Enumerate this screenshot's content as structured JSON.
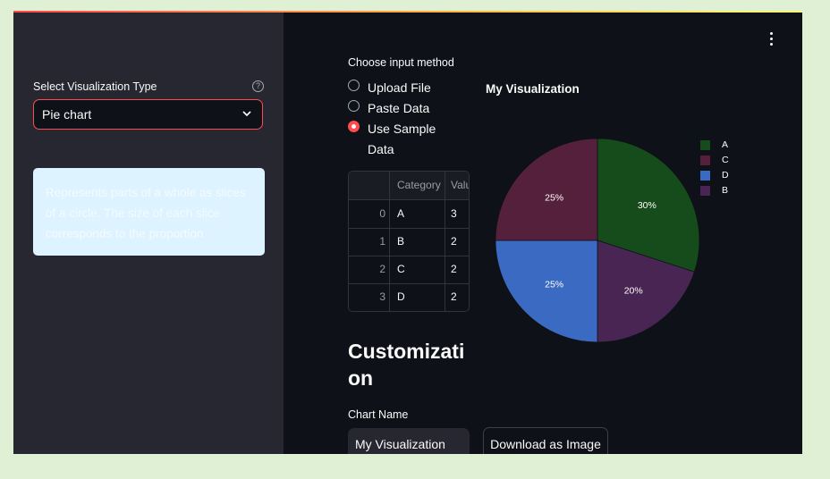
{
  "sidebar": {
    "label": "Select Visualization Type",
    "help_icon": "?",
    "select_value": "Pie chart",
    "info_text": "Represents parts of a whole as slices of a circle. The size of each slice corresponds to the proportion"
  },
  "main": {
    "input_label": "Choose input method",
    "radio_options": [
      {
        "label": "Upload File",
        "selected": false
      },
      {
        "label": "Paste Data",
        "selected": false
      },
      {
        "label": "Use Sample",
        "selected": true
      },
      {
        "label": "Data",
        "selected": false
      }
    ],
    "table": {
      "headers": [
        "",
        "Category",
        "Valu"
      ],
      "rows": [
        [
          "0",
          "A",
          "3"
        ],
        [
          "1",
          "B",
          "2"
        ],
        [
          "2",
          "C",
          "2"
        ],
        [
          "3",
          "D",
          "2"
        ]
      ]
    },
    "heading": "Customizati on",
    "chart_name_label": "Chart Name",
    "chart_name_value": "My Visualization",
    "download_label": "Download as Image"
  },
  "colors": {
    "accent": "#ff4b4b",
    "A": "#164b1b",
    "B": "#482552",
    "C": "#55203c",
    "D": "#3a6ac2"
  },
  "chart_data": {
    "type": "pie",
    "title": "My Visualization",
    "slices": [
      {
        "label": "A",
        "value": 30,
        "text": "30%"
      },
      {
        "label": "B",
        "value": 20,
        "text": "20%"
      },
      {
        "label": "D",
        "value": 25,
        "text": "25%"
      },
      {
        "label": "C",
        "value": 25,
        "text": "25%"
      }
    ],
    "legend_order": [
      "A",
      "C",
      "D",
      "B"
    ],
    "legend_position": "right"
  }
}
